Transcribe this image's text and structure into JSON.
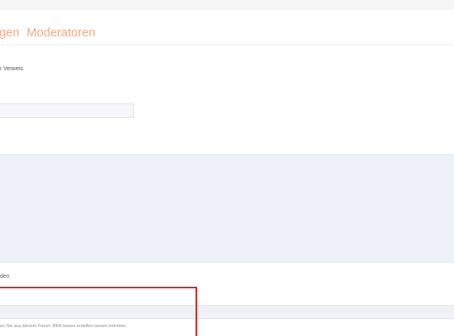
{
  "tabs": [
    {
      "label": "gen"
    },
    {
      "label": "Moderatoren"
    }
  ],
  "form": {
    "label_top": "r Verweis",
    "short_input_value": "",
    "textarea_value": "",
    "label_bottom": "den",
    "long_input_value": "",
    "hint": "en Sie aus diesem Forum JIRA Issues erstellen lassen möchten."
  },
  "colors": {
    "tab_text": "#f0a988",
    "highlight": "#e0242c",
    "field_background": "#eef2f8"
  }
}
